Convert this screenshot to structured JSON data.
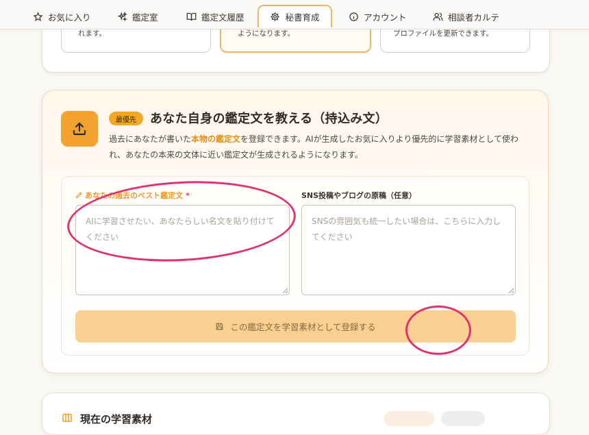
{
  "nav": {
    "tabs": [
      {
        "label": "お気に入り",
        "icon": "star-icon"
      },
      {
        "label": "鑑定室",
        "icon": "sparkles-icon"
      },
      {
        "label": "鑑定文履歴",
        "icon": "book-icon"
      },
      {
        "label": "秘書育成",
        "icon": "gear-icon",
        "active": true
      },
      {
        "label": "アカウント",
        "icon": "info-icon"
      },
      {
        "label": "相談者カルテ",
        "icon": "users-icon"
      }
    ]
  },
  "top_cards": [
    {
      "text": "れます。"
    },
    {
      "text": "ようになります。"
    },
    {
      "text": "プロファイルを更新できます。"
    }
  ],
  "main": {
    "badge": "最優先",
    "title": "あなた自身の鑑定文を教える（持込み文）",
    "desc_pre": "過去にあなたが書いた",
    "desc_em": "本物の鑑定文",
    "desc_post": "を登録できます。AIが生成したお気に入りより優先的に学習素材として使われ、あなたの本来の文体に近い鑑定文が生成されるようになります。",
    "field1": {
      "label": "あなたの過去のベスト鑑定文",
      "required": "*",
      "placeholder": "AIに学習させたい、あなたらしい名文を貼り付けてください"
    },
    "field2": {
      "label": "SNS投稿やブログの原稿（任意）",
      "placeholder": "SNSの雰囲気も統一したい場合は、こちらに入力してください"
    },
    "submit_label": "この鑑定文を学習素材として登録する"
  },
  "bottom": {
    "title_partial": "現在の学習素材"
  },
  "colors": {
    "accent": "#f4a22d",
    "button_disabled": "#f9cf92",
    "annotation": "#e0336d"
  }
}
